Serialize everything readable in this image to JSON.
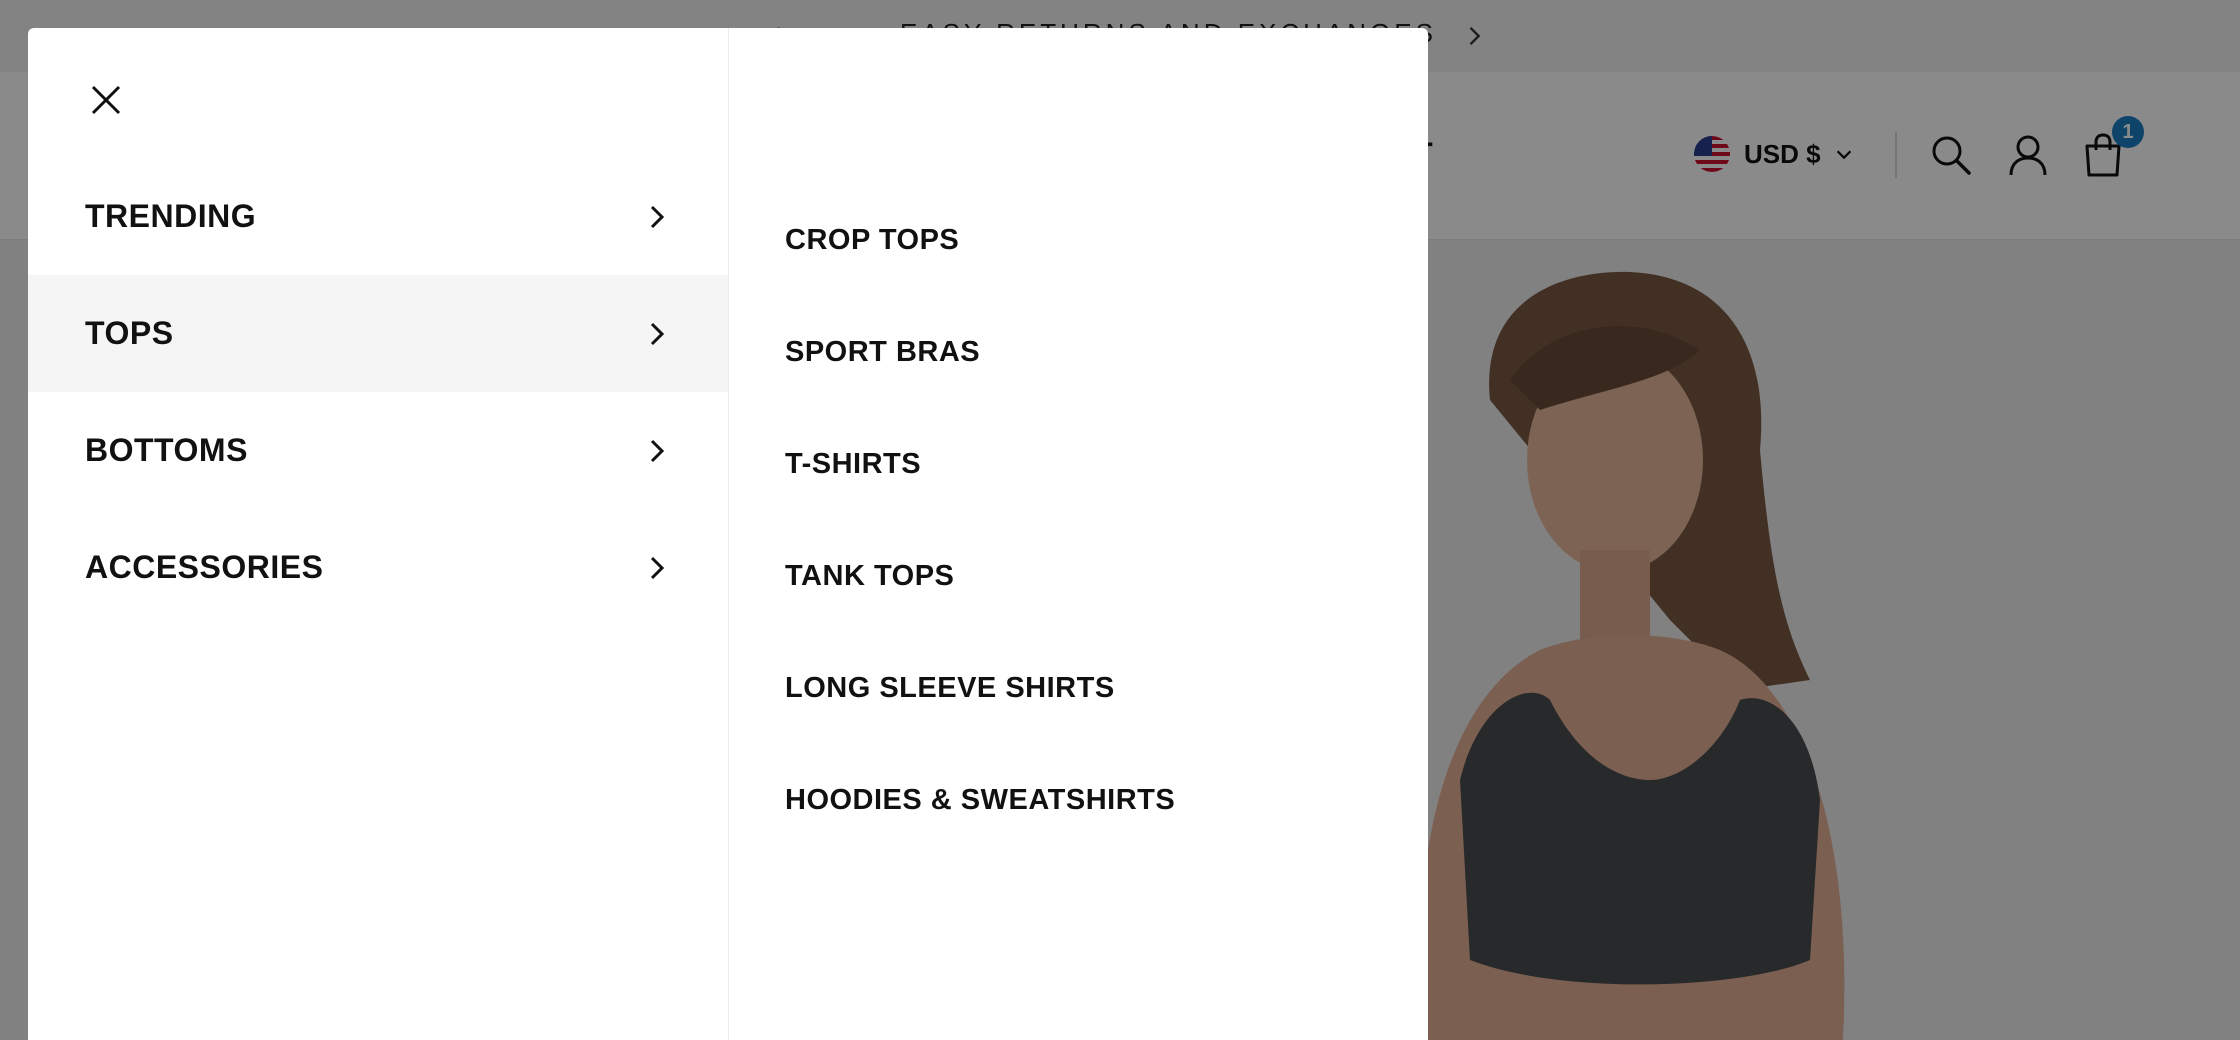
{
  "announcement": {
    "message": "EASY RETURNS AND EXCHANGES"
  },
  "header": {
    "nav_partial_text": "CT",
    "currency_label": "USD $",
    "cart_count": "1"
  },
  "menu": {
    "primary_items": [
      {
        "label": "TRENDING",
        "active": false
      },
      {
        "label": "TOPS",
        "active": true
      },
      {
        "label": "BOTTOMS",
        "active": false
      },
      {
        "label": "ACCESSORIES",
        "active": false
      }
    ],
    "sub_items": [
      {
        "label": "CROP TOPS"
      },
      {
        "label": "SPORT BRAS"
      },
      {
        "label": "T-SHIRTS"
      },
      {
        "label": "TANK TOPS"
      },
      {
        "label": "LONG SLEEVE SHIRTS"
      },
      {
        "label": "HOODIES & SWEATSHIRTS"
      }
    ]
  },
  "icons": {
    "close": "close-icon",
    "chevron_right": "chevron-right-icon",
    "search": "search-icon",
    "account": "user-icon",
    "cart": "shopping-bag-icon",
    "flag": "us-flag-icon"
  },
  "colors": {
    "overlay": "#000000",
    "active_item_bg": "#f5f5f5",
    "cart_badge": "#1b7fc4",
    "text": "#111111"
  }
}
